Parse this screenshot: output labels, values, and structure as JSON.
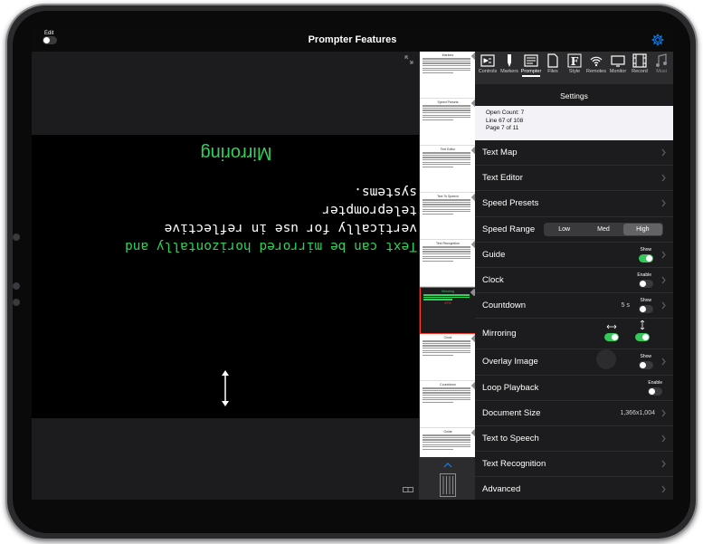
{
  "header": {
    "title": "Prompter Features",
    "edit_label": "Edit",
    "edit_on": false
  },
  "prompt": {
    "heading": "Mirroring",
    "lines_green": [
      "Text can be mirrored horizontally and"
    ],
    "lines_white": [
      "vertically for use in reflective teleprompter",
      "systems."
    ]
  },
  "thumbnails": [
    {
      "label": "Markers"
    },
    {
      "label": "Speed Presets"
    },
    {
      "label": "Text Editor"
    },
    {
      "label": "Text To Speech"
    },
    {
      "label": "Text Recognition"
    },
    {
      "label": "Mirroring",
      "highlighted": true,
      "progress": "67%"
    },
    {
      "label": "Clock"
    },
    {
      "label": "Countdown"
    },
    {
      "label": "Guide"
    }
  ],
  "toolbar": {
    "items": [
      {
        "label": "Controls",
        "icon": "controls-icon"
      },
      {
        "label": "Markers",
        "icon": "marker-pen-icon"
      },
      {
        "label": "Prompter",
        "icon": "prompter-icon",
        "active": true
      },
      {
        "label": "Files",
        "icon": "file-icon"
      },
      {
        "label": "Style",
        "icon": "font-style-icon"
      },
      {
        "label": "Remotes",
        "icon": "wireless-icon"
      },
      {
        "label": "Monitor",
        "icon": "monitor-icon"
      },
      {
        "label": "Record",
        "icon": "film-icon"
      },
      {
        "label": "Musi",
        "icon": "music-icon"
      }
    ]
  },
  "settings": {
    "title": "Settings",
    "info": {
      "open_count": "Open Count: 7",
      "line": "Line 67 of 108",
      "page": "Page 7 of 11"
    },
    "rows": {
      "text_map": "Text Map",
      "text_editor": "Text Editor",
      "speed_presets": "Speed Presets",
      "speed_range": "Speed Range",
      "guide": "Guide",
      "clock": "Clock",
      "countdown": "Countdown",
      "mirroring": "Mirroring",
      "overlay_image": "Overlay Image",
      "loop_playback": "Loop Playback",
      "document_size": "Document Size",
      "text_to_speech": "Text to Speech",
      "text_recognition": "Text Recognition",
      "advanced": "Advanced"
    },
    "speed_range_options": [
      "Low",
      "Med",
      "High"
    ],
    "speed_range_selected": "High",
    "guide_caption": "Show",
    "guide_on": true,
    "clock_caption": "Enable",
    "clock_on": false,
    "countdown_value": "5 s",
    "countdown_caption": "Show",
    "countdown_on": false,
    "mirror_horizontal_on": true,
    "mirror_vertical_on": true,
    "overlay_caption": "Show",
    "overlay_on": false,
    "loop_caption": "Enable",
    "loop_on": false,
    "document_size_value": "1,366x1,004"
  },
  "colors": {
    "accent_green": "#30d158",
    "toggle_on": "#34c759",
    "gear_blue": "#0a84ff",
    "highlight_red": "#ff3b30"
  }
}
